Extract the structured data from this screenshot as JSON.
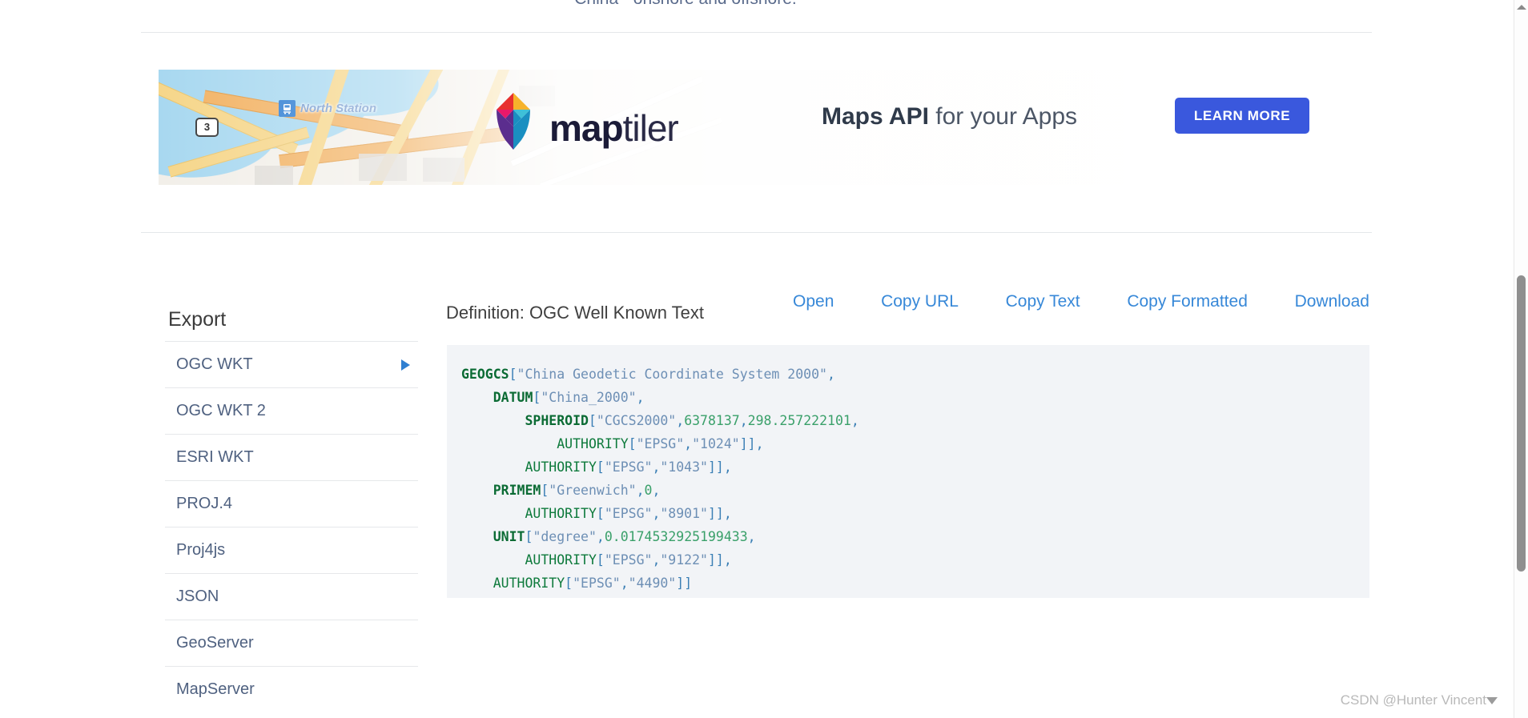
{
  "page": {
    "top_partial_text": "China - onshore and offshore.",
    "watermark": "CSDN @Hunter Vincent"
  },
  "ad": {
    "brand_bold": "map",
    "brand_light": "tiler",
    "tagline_bold": "Maps API",
    "tagline_rest": " for your Apps",
    "cta_label": "LEARN MORE",
    "map_route_shield": "3",
    "map_station_label": "North Station",
    "cta_color": "#3a58dd",
    "station_icon": "train-station-icon"
  },
  "sidebar": {
    "title": "Export",
    "items": [
      {
        "label": "OGC WKT",
        "has_caret": true
      },
      {
        "label": "OGC WKT 2",
        "has_caret": false
      },
      {
        "label": "ESRI WKT",
        "has_caret": false
      },
      {
        "label": "PROJ.4",
        "has_caret": false
      },
      {
        "label": "Proj4js",
        "has_caret": false
      },
      {
        "label": "JSON",
        "has_caret": false
      },
      {
        "label": "GeoServer",
        "has_caret": false
      },
      {
        "label": "MapServer",
        "has_caret": false
      }
    ]
  },
  "definition": {
    "title": "Definition: OGC Well Known Text",
    "actions": [
      {
        "label": "Open"
      },
      {
        "label": "Copy URL"
      },
      {
        "label": "Copy Text"
      },
      {
        "label": "Copy Formatted"
      },
      {
        "label": "Download"
      }
    ],
    "code_text": "GEOGCS[\"China Geodetic Coordinate System 2000\",\n    DATUM[\"China_2000\",\n        SPHEROID[\"CGCS2000\",6378137,298.257222101,\n            AUTHORITY[\"EPSG\",\"1024\"]],\n        AUTHORITY[\"EPSG\",\"1043\"]],\n    PRIMEM[\"Greenwich\",0,\n        AUTHORITY[\"EPSG\",\"8901\"]],\n    UNIT[\"degree\",0.0174532925199433,\n        AUTHORITY[\"EPSG\",\"9122\"]],\n    AUTHORITY[\"EPSG\",\"4490\"]]",
    "code_lines": [
      {
        "indent": 0,
        "kw": "GEOGCS",
        "rest": "[\"China Geodetic Coordinate System 2000\","
      },
      {
        "indent": 4,
        "kw": "DATUM",
        "rest": "[\"China_2000\","
      },
      {
        "indent": 8,
        "kw": "SPHEROID",
        "rest": "[\"CGCS2000\",6378137,298.257222101,"
      },
      {
        "indent": 12,
        "kw": "AUTHORITY",
        "rest": "[\"EPSG\",\"1024\"]],"
      },
      {
        "indent": 8,
        "kw": "AUTHORITY",
        "rest": "[\"EPSG\",\"1043\"]],"
      },
      {
        "indent": 4,
        "kw": "PRIMEM",
        "rest": "[\"Greenwich\",0,"
      },
      {
        "indent": 8,
        "kw": "AUTHORITY",
        "rest": "[\"EPSG\",\"8901\"]],"
      },
      {
        "indent": 4,
        "kw": "UNIT",
        "rest": "[\"degree\",0.0174532925199433,"
      },
      {
        "indent": 8,
        "kw": "AUTHORITY",
        "rest": "[\"EPSG\",\"9122\"]],"
      },
      {
        "indent": 4,
        "kw": "AUTHORITY",
        "rest": "[\"EPSG\",\"4490\"]]"
      }
    ]
  }
}
